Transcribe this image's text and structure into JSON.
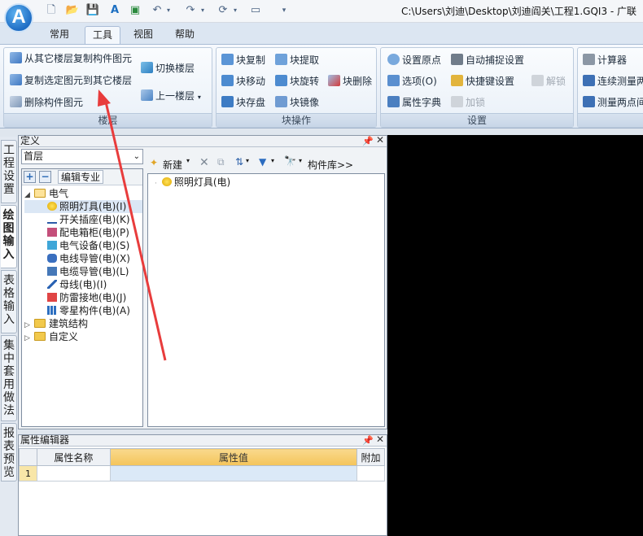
{
  "title_bar": {
    "app_logo": "A",
    "path": "C:\\Users\\刘迪\\Desktop\\刘迪阎关\\工程1.GQI3 - 广联"
  },
  "tabs": [
    {
      "label": "常用"
    },
    {
      "label": "工具",
      "active": true
    },
    {
      "label": "视图"
    },
    {
      "label": "帮助"
    }
  ],
  "ribbon": {
    "floor_group": {
      "title": "楼层",
      "copy_from_other": "从其它楼层复制构件图元",
      "copy_to_other": "复制选定图元到其它楼层",
      "delete_elements": "删除构件图元",
      "switch_floor": "切换楼层",
      "upper_floor": "上一楼层"
    },
    "block_group": {
      "title": "块操作",
      "copy": "块复制",
      "extract": "块提取",
      "move": "块移动",
      "rotate": "块旋转",
      "delete": "块删除",
      "save": "块存盘",
      "mirror": "块镜像"
    },
    "settings_group": {
      "title": "设置",
      "set_origin": "设置原点",
      "auto_snap": "自动捕捉设置",
      "options": "选项(O)",
      "shortcut": "快捷键设置",
      "unlock": "解锁",
      "attr_dict": "属性字典",
      "lock": "加锁"
    },
    "tools_group": {
      "calculator": "计算器",
      "continuous_measure": "连续测量两",
      "measure_two_points": "测量两点间"
    }
  },
  "side_tabs": [
    "工程设置",
    "绘图输入",
    "表格输入",
    "集中套用做法",
    "报表预览"
  ],
  "definition_panel": {
    "title": "定义",
    "floor": "首层",
    "edit_specialty": "编辑专业",
    "tree": {
      "root": "电气",
      "items": [
        {
          "label": "照明灯具(电)(I)",
          "selected": true
        },
        {
          "label": "开关插座(电)(K)"
        },
        {
          "label": "配电箱柜(电)(P)"
        },
        {
          "label": "电气设备(电)(S)"
        },
        {
          "label": "电线导管(电)(X)"
        },
        {
          "label": "电缆导管(电)(L)"
        },
        {
          "label": "母线(电)(I)"
        },
        {
          "label": "防雷接地(电)(J)"
        },
        {
          "label": "零星构件(电)(A)"
        }
      ],
      "other_roots": [
        "建筑结构",
        "自定义"
      ]
    },
    "toolbar": {
      "new": "新建",
      "component_lib": "构件库>>"
    },
    "list": [
      {
        "label": "照明灯具(电)"
      }
    ]
  },
  "property_panel": {
    "title": "属性编辑器",
    "columns": [
      "属性名称",
      "属性值",
      "附加"
    ],
    "rows": [
      {
        "num": "1",
        "name": "",
        "value": "",
        "extra": ""
      }
    ]
  },
  "colors": {
    "annotation_arrow": "#e83c3c",
    "header_highlight": "#f4c45a",
    "canvas": "#000000"
  }
}
